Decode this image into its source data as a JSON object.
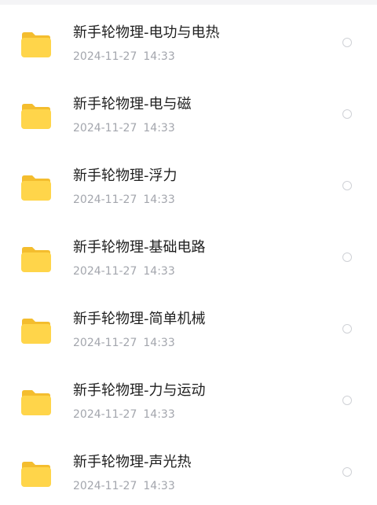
{
  "icons": {
    "folder": "folder-icon",
    "select": "radio-circle-icon"
  },
  "colors": {
    "folder_front": "#FFD54A",
    "folder_back": "#F4BD2E",
    "name_text": "#1F1F1F",
    "meta_text": "#A3A6AD"
  },
  "files": [
    {
      "name": "新手轮物理-电功与电热",
      "date": "2024-11-27",
      "time": "14:33"
    },
    {
      "name": "新手轮物理-电与磁",
      "date": "2024-11-27",
      "time": "14:33"
    },
    {
      "name": "新手轮物理-浮力",
      "date": "2024-11-27",
      "time": "14:33"
    },
    {
      "name": "新手轮物理-基础电路",
      "date": "2024-11-27",
      "time": "14:33"
    },
    {
      "name": "新手轮物理-简单机械",
      "date": "2024-11-27",
      "time": "14:33"
    },
    {
      "name": "新手轮物理-力与运动",
      "date": "2024-11-27",
      "time": "14:33"
    },
    {
      "name": "新手轮物理-声光热",
      "date": "2024-11-27",
      "time": "14:33"
    }
  ]
}
